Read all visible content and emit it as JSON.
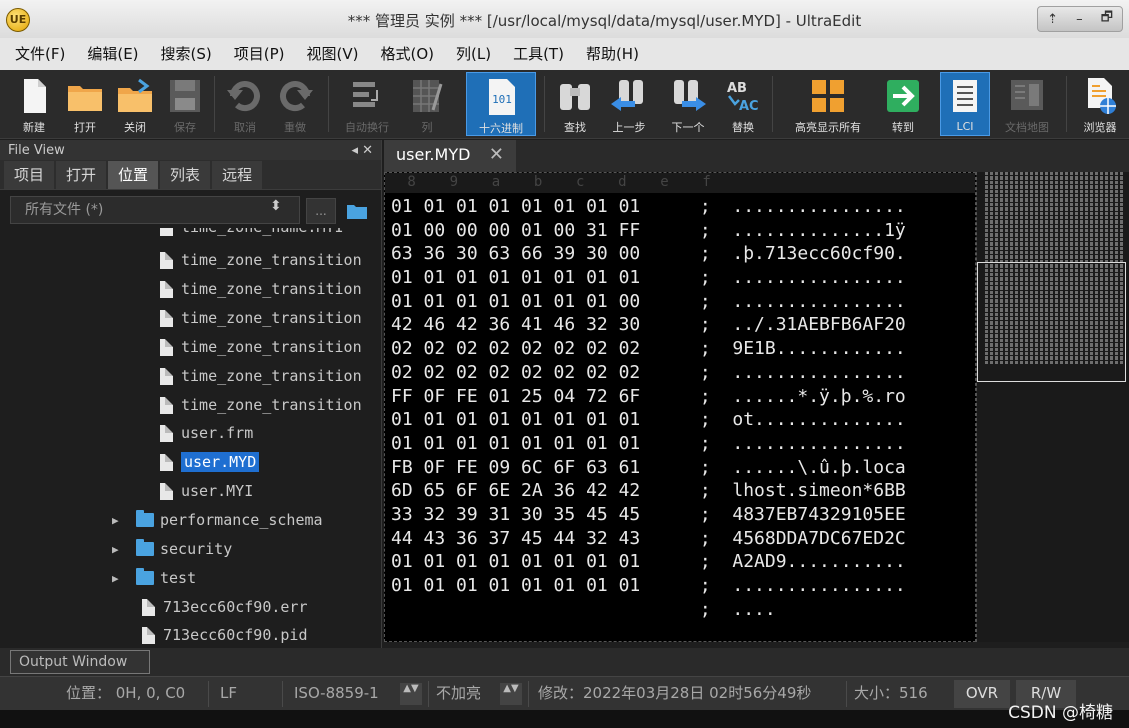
{
  "window": {
    "title": "*** 管理员 实例 ***   [/usr/local/mysql/data/mysql/user.MYD] - UltraEdit",
    "app_icon_text": "UE",
    "controls": [
      "⇡",
      "–",
      "🗗"
    ]
  },
  "menu": [
    "文件(F)",
    "编辑(E)",
    "搜索(S)",
    "项目(P)",
    "视图(V)",
    "格式(O)",
    "列(L)",
    "工具(T)",
    "帮助(H)"
  ],
  "toolbar": {
    "new": "新建",
    "open": "打开",
    "close": "关闭",
    "save": "保存",
    "undo": "取消",
    "redo": "重做",
    "wrap": "自动换行",
    "column": "列",
    "hex": "十六进制",
    "hex_icon_text": "101",
    "find": "查找",
    "prev": "上一步",
    "next": "下一个",
    "replace": "替换",
    "replace_icon_top": "AB",
    "replace_icon_bottom": "AC",
    "highlight_all": "高亮显示所有",
    "goto": "转到",
    "lci": "LCI",
    "doc_map": "文档地图",
    "browser": "浏览器"
  },
  "file_view": {
    "title": "File View",
    "header_controls": "◂ ✕",
    "tabs": [
      "项目",
      "打开",
      "位置",
      "列表",
      "远程"
    ],
    "active_tab": "位置",
    "filter": "所有文件 (*)",
    "filter_button": "...",
    "tree": [
      {
        "type": "file",
        "name": "time_zone_name.MYI"
      },
      {
        "type": "file",
        "name": "time_zone_transition"
      },
      {
        "type": "file",
        "name": "time_zone_transition"
      },
      {
        "type": "file",
        "name": "time_zone_transition"
      },
      {
        "type": "file",
        "name": "time_zone_transition"
      },
      {
        "type": "file",
        "name": "time_zone_transition"
      },
      {
        "type": "file",
        "name": "time_zone_transition"
      },
      {
        "type": "file",
        "name": "user.frm"
      },
      {
        "type": "file",
        "name": "user.MYD",
        "selected": true
      },
      {
        "type": "file",
        "name": "user.MYI"
      },
      {
        "type": "folder",
        "name": "performance_schema"
      },
      {
        "type": "folder",
        "name": "security"
      },
      {
        "type": "folder",
        "name": "test"
      },
      {
        "type": "file",
        "name": "713ecc60cf90.err"
      },
      {
        "type": "file",
        "name": "713ecc60cf90.pid"
      }
    ]
  },
  "editor": {
    "tab_label": "user.MYD",
    "tab_close": "✕",
    "ruler": " 8    9    a    b    c    d    e    f",
    "lines": [
      {
        "hex": "01 01 01 01 01 01 01 01",
        "ascii": "................"
      },
      {
        "hex": "01 00 00 00 01 00 31 FF",
        "ascii": "..............1ÿ"
      },
      {
        "hex": "63 36 30 63 66 39 30 00",
        "ascii": ".þ.713ecc60cf90."
      },
      {
        "hex": "01 01 01 01 01 01 01 01",
        "ascii": "................"
      },
      {
        "hex": "01 01 01 01 01 01 01 00",
        "ascii": "................"
      },
      {
        "hex": "42 46 42 36 41 46 32 30",
        "ascii": "../.31AEBFB6AF20"
      },
      {
        "hex": "02 02 02 02 02 02 02 02",
        "ascii": "9E1B............"
      },
      {
        "hex": "02 02 02 02 02 02 02 02",
        "ascii": "................"
      },
      {
        "hex": "FF 0F FE 01 25 04 72 6F",
        "ascii": "......*.ÿ.þ.%.ro"
      },
      {
        "hex": "01 01 01 01 01 01 01 01",
        "ascii": "ot.............."
      },
      {
        "hex": "01 01 01 01 01 01 01 01",
        "ascii": "................"
      },
      {
        "hex": "FB 0F FE 09 6C 6F 63 61",
        "ascii": "......\\.û.þ.loca"
      },
      {
        "hex": "6D 65 6F 6E 2A 36 42 42",
        "ascii": "lhost.simeon*6BB"
      },
      {
        "hex": "33 32 39 31 30 35 45 45",
        "ascii": "4837EB74329105EE"
      },
      {
        "hex": "44 43 36 37 45 44 32 43",
        "ascii": "4568DDA7DC67ED2C"
      },
      {
        "hex": "01 01 01 01 01 01 01 01",
        "ascii": "A2AD9..........."
      },
      {
        "hex": "01 01 01 01 01 01 01 01",
        "ascii": "................"
      },
      {
        "hex": "",
        "ascii": "...."
      }
    ]
  },
  "output_window": {
    "label": "Output Window"
  },
  "status_bar": {
    "position": "位置： 0H, 0, C0",
    "line_ending": "LF",
    "encoding": "ISO-8859-1",
    "highlight": "不加亮",
    "modified": "修改：2022年03月28日 02时56分49秒",
    "size": "大小：516",
    "ovr": "OVR",
    "rw": "R/W",
    "spin_glyph": "▲▼"
  },
  "watermark": "CSDN @椅糖",
  "colors": {
    "selection": "#1f6fd1",
    "hex_active": "#1f6fb7",
    "folder": "#4aa3e0"
  }
}
